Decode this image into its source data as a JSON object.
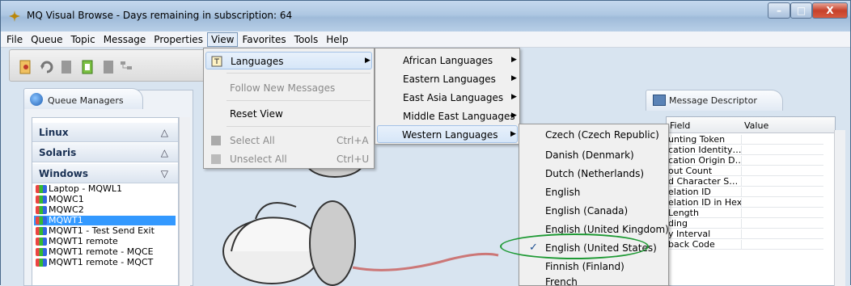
{
  "window": {
    "title": "MQ Visual Browse - Days remaining in subscription: 64",
    "controls": {
      "minimize": "–",
      "maximize": "□",
      "close": "X"
    }
  },
  "menubar": {
    "items": [
      "File",
      "Queue",
      "Topic",
      "Message",
      "Properties",
      "View",
      "Favorites",
      "Tools",
      "Help"
    ],
    "open_item": "View"
  },
  "view_menu": {
    "items": [
      {
        "label": "Languages",
        "submenu": true,
        "enabled": true,
        "highlighted": true
      },
      {
        "label": "Follow New Messages",
        "enabled": false
      },
      {
        "label": "Reset View",
        "enabled": true
      },
      {
        "label": "Select All",
        "shortcut": "Ctrl+A",
        "enabled": false
      },
      {
        "label": "Unselect All",
        "shortcut": "Ctrl+U",
        "enabled": false
      }
    ]
  },
  "languages_menu": {
    "items": [
      {
        "label": "African Languages",
        "submenu": true
      },
      {
        "label": "Eastern Languages",
        "submenu": true
      },
      {
        "label": "East Asia Languages",
        "submenu": true
      },
      {
        "label": "Middle East Languages",
        "submenu": true
      },
      {
        "label": "Western Languages",
        "submenu": true,
        "highlighted": true
      }
    ]
  },
  "western_menu": {
    "items": [
      {
        "label": "Czech (Czech Republic)",
        "checked": false
      },
      {
        "label": "Danish (Denmark)",
        "checked": false
      },
      {
        "label": "Dutch (Netherlands)",
        "checked": false
      },
      {
        "label": "English",
        "checked": false
      },
      {
        "label": "English (Canada)",
        "checked": false
      },
      {
        "label": "English (United Kingdom)",
        "checked": false
      },
      {
        "label": "English (United States)",
        "checked": true
      },
      {
        "label": "Finnish (Finland)",
        "checked": false
      },
      {
        "label": "French",
        "checked": false
      }
    ],
    "check_glyph": "✓"
  },
  "queue_managers": {
    "tab_label": "Queue Managers",
    "groups": [
      {
        "label": "Linux",
        "expanded": false
      },
      {
        "label": "Solaris",
        "expanded": false
      },
      {
        "label": "Windows",
        "expanded": true
      }
    ],
    "items": [
      {
        "label": "Laptop - MQWL1",
        "selected": false
      },
      {
        "label": "MQWC1",
        "selected": false
      },
      {
        "label": "MQWC2",
        "selected": false
      },
      {
        "label": "MQWT1",
        "selected": true
      },
      {
        "label": "MQWT1 - Test Send Exit",
        "selected": false
      },
      {
        "label": "MQWT1 remote",
        "selected": false
      },
      {
        "label": "MQWT1 remote - MQCE",
        "selected": false
      },
      {
        "label": "MQWT1 remote - MQCT",
        "selected": false
      }
    ]
  },
  "message_descriptor": {
    "tab_label": "Message Descriptor",
    "columns": [
      "Field",
      "Value"
    ],
    "rows": [
      "unting Token",
      "cation Identity…",
      "cation Origin D…",
      "out Count",
      "d Character S…",
      "elation ID",
      "elation ID in Hex",
      "Length",
      "ding",
      "y Interval",
      "back Code"
    ]
  },
  "colors": {
    "selection": "#3399ff",
    "highlight_ellipse": "#1f9a35"
  }
}
